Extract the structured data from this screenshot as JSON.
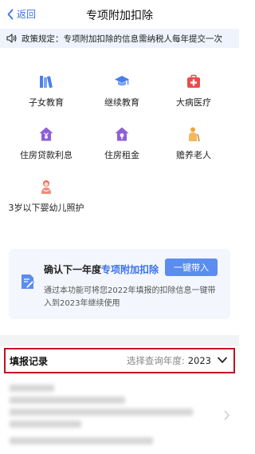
{
  "header": {
    "back_label": "返回",
    "title": "专项附加扣除"
  },
  "policy": {
    "text": "政策规定：专项附加扣除的信息需纳税人每年提交一次"
  },
  "categories": [
    {
      "label": "子女教育",
      "icon": "books-icon",
      "color": "#4a7fe8"
    },
    {
      "label": "继续教育",
      "icon": "graduation-cap-icon",
      "color": "#4a7fe8"
    },
    {
      "label": "大病医疗",
      "icon": "medical-kit-icon",
      "color": "#ea4d4d"
    },
    {
      "label": "住房贷款利息",
      "icon": "house-yuan-icon",
      "color": "#8f5fd9"
    },
    {
      "label": "住房租金",
      "icon": "house-rent-icon",
      "color": "#8f5fd9"
    },
    {
      "label": "赡养老人",
      "icon": "elderly-icon",
      "color": "#f0a43a"
    },
    {
      "label": "3岁以下婴幼儿照护",
      "icon": "baby-icon",
      "color": "#ea6a55"
    }
  ],
  "card": {
    "title_prefix": "确认下一年度",
    "title_highlight": "专项附加扣除",
    "button_label": "一键带入",
    "description": "通过本功能可将您2022年填报的扣除信息一键带入到2023年继续使用"
  },
  "records": {
    "label": "填报记录",
    "query_label": "选择查询年度:",
    "year": "2023"
  },
  "colors": {
    "accent": "#3b72e6",
    "highlight_border": "#c1121f"
  }
}
